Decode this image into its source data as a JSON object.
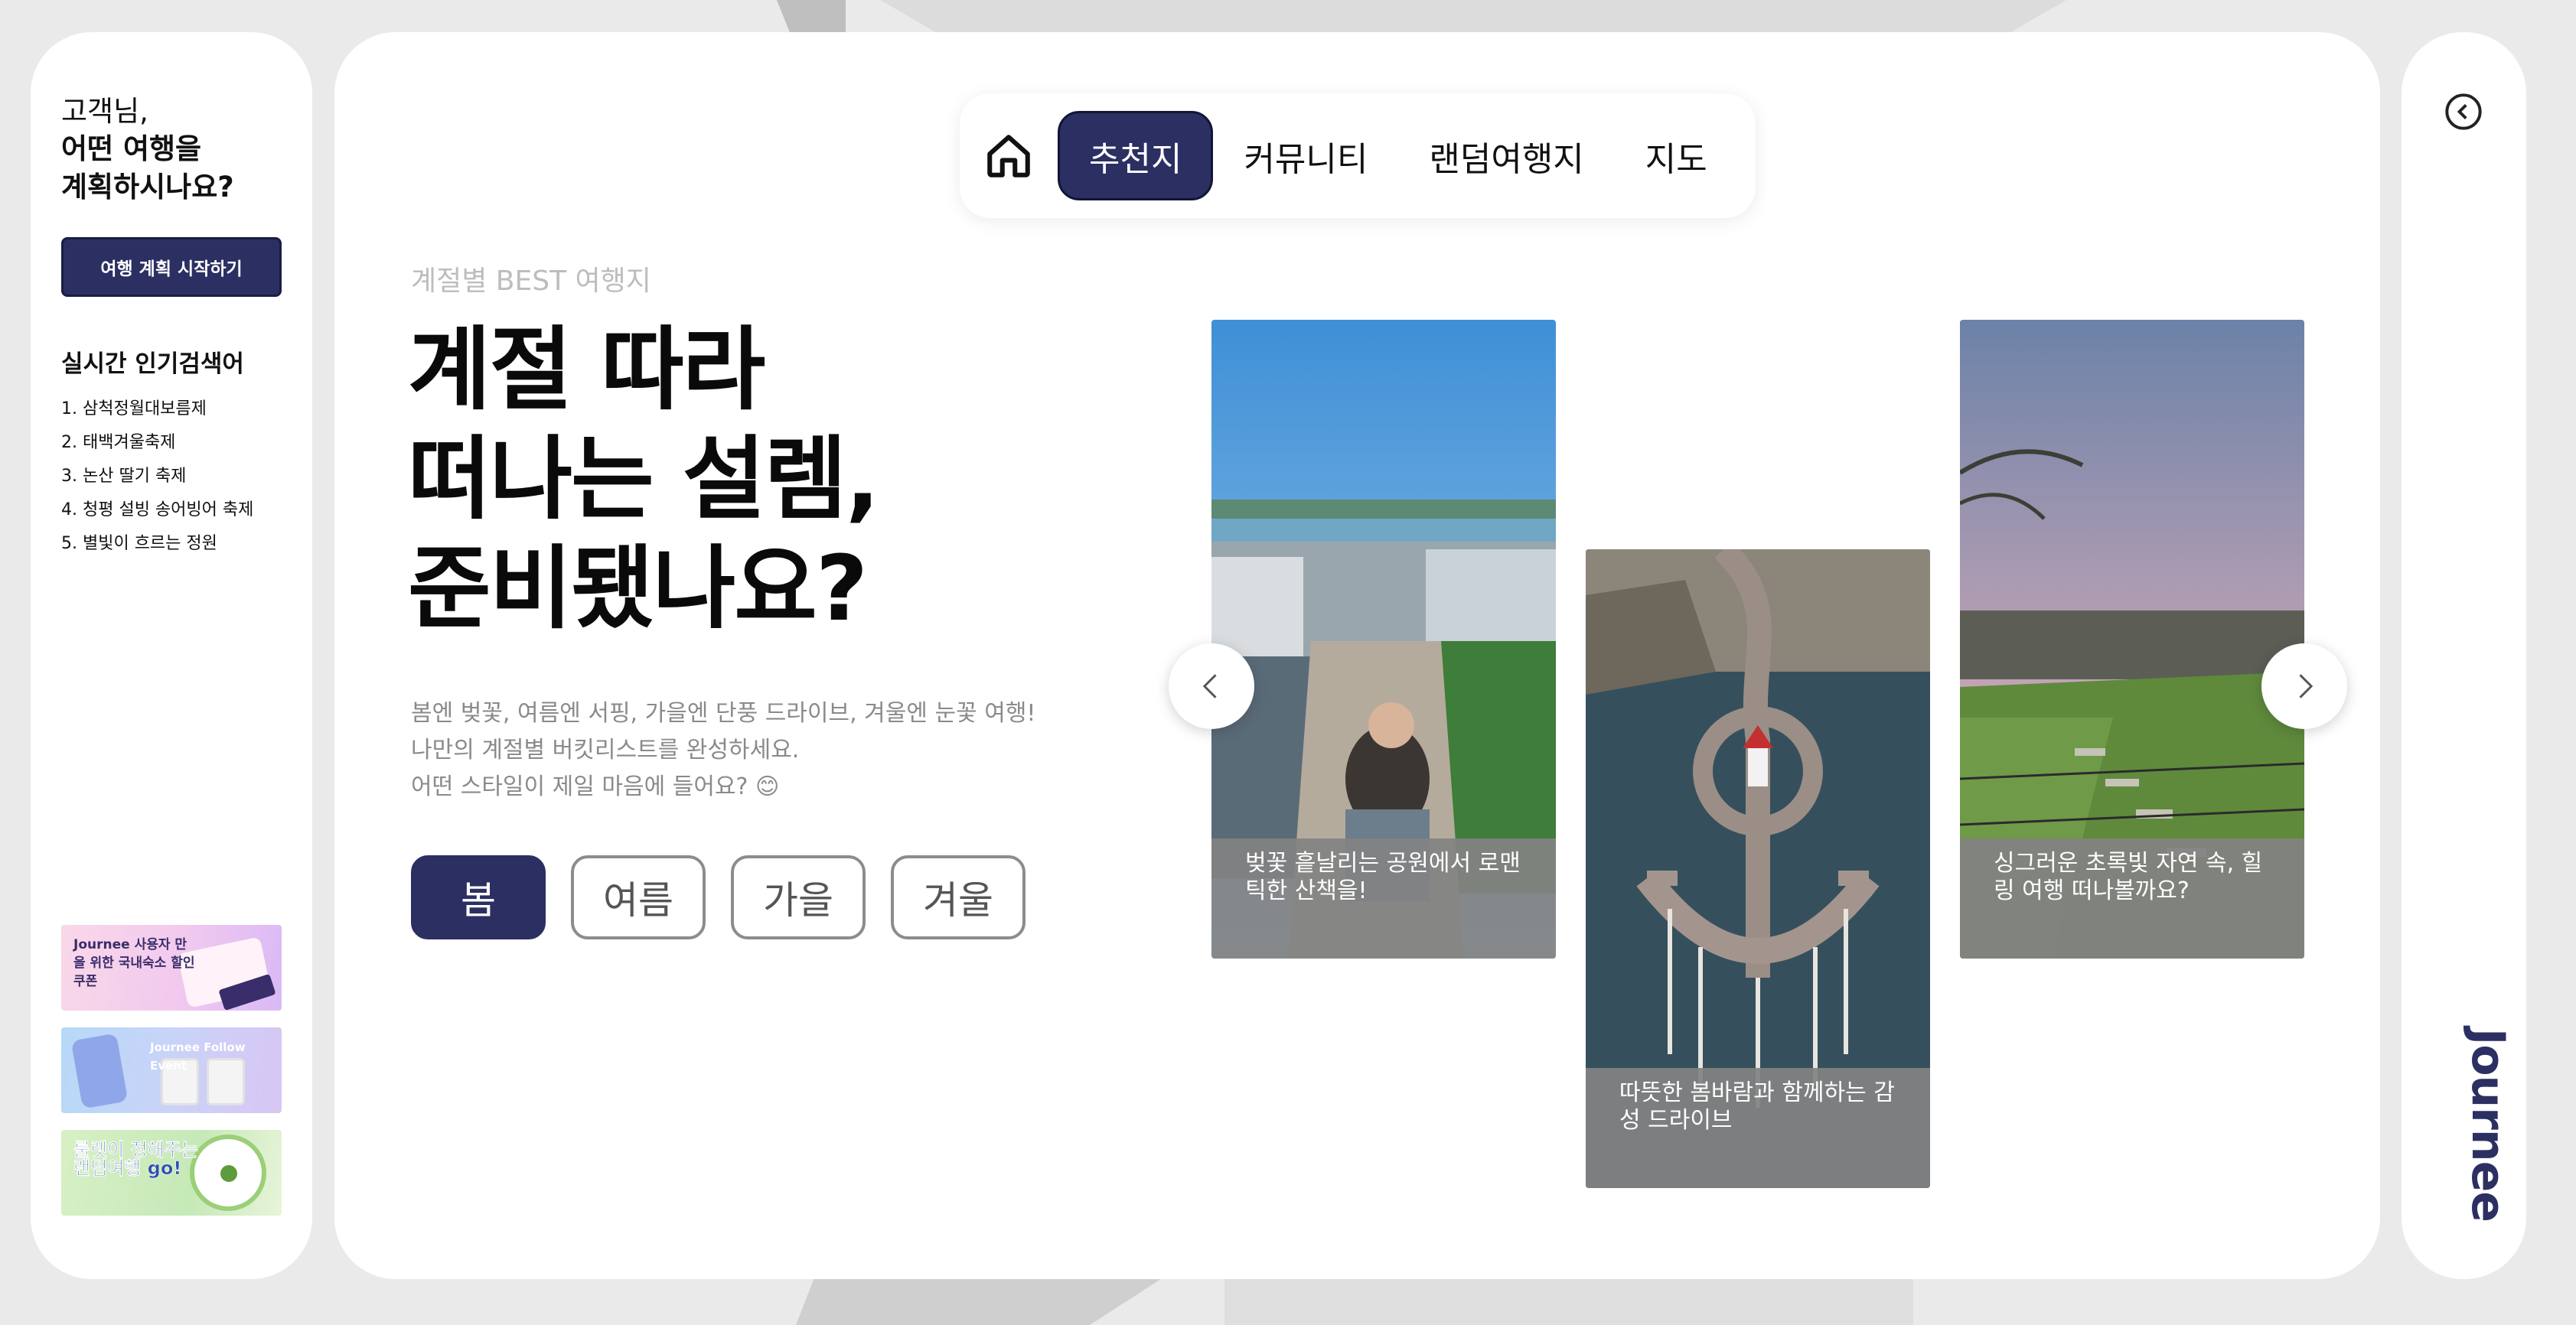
{
  "sidebar": {
    "greeting_line1": "고객님,",
    "greeting_line2": "어떤 여행을",
    "greeting_line3": "계획하시나요?",
    "start_button": "여행 계획 시작하기",
    "popular_title": "실시간 인기검색어",
    "popular_items": [
      "1. 삼척정월대보름제",
      "2. 태백겨울축제",
      "3. 논산 딸기 축제",
      "4. 청평 설빙 송어빙어 축제",
      "5. 별빛이 흐르는 정원"
    ],
    "banners": [
      {
        "text": "Journee 사용자 만을 위한 국내숙소 할인쿠폰"
      },
      {
        "text": "Journee Follow Event"
      },
      {
        "text": "룰렛이 정해주는 랜덤여행 go!"
      }
    ]
  },
  "nav": {
    "home_icon": "home-icon",
    "tabs": [
      "추천지",
      "커뮤니티",
      "랜덤여행지",
      "지도"
    ],
    "active_tab": "추천지"
  },
  "main": {
    "eyebrow": "계절별 BEST 여행지",
    "headline": [
      "계절 따라",
      "떠나는 설렘,",
      "준비됐나요?"
    ],
    "description": [
      "봄엔 벚꽃, 여름엔 서핑, 가을엔 단풍 드라이브, 겨울엔 눈꽃 여행!",
      "나만의 계절별 버킷리스트를 완성하세요.",
      "어떤 스타일이 제일 마음에 들어요? 😊"
    ],
    "seasons": [
      "봄",
      "여름",
      "가을",
      "겨울"
    ],
    "active_season": "봄"
  },
  "cards": [
    {
      "caption": "벚꽃 흩날리는 공원에서 로맨틱한 산책을!"
    },
    {
      "caption": "따뜻한 봄바람과 함께하는 감성 드라이브"
    },
    {
      "caption": "싱그러운 초록빛 자연 속, 힐링 여행 떠나볼까요?"
    }
  ],
  "right_panel": {
    "collapse_icon": "chevron-left-circle-icon",
    "logo": "Journee"
  },
  "colors": {
    "accent": "#2b2f62",
    "background": "#eaeaea",
    "panel": "#ffffff"
  }
}
